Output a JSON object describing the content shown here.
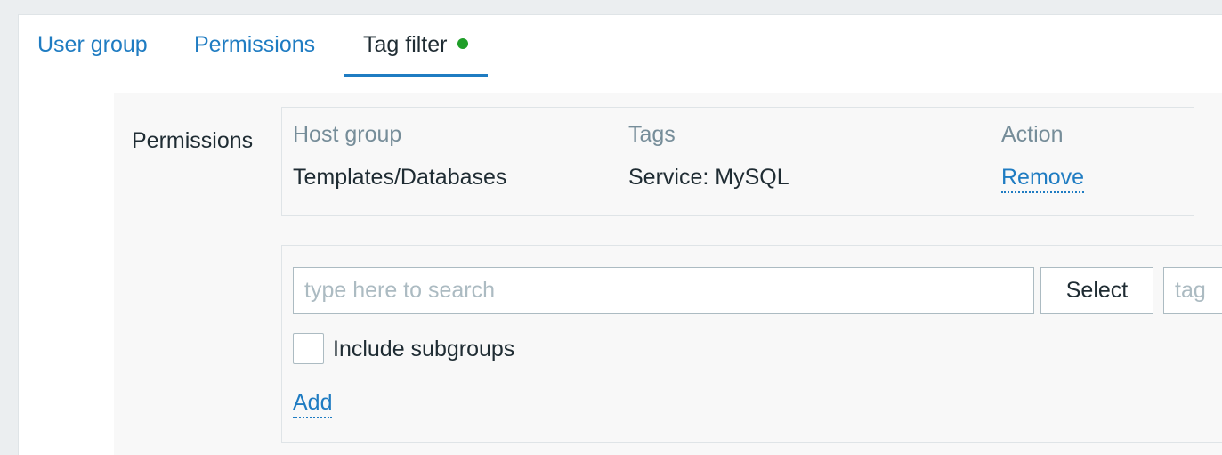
{
  "tabs": [
    {
      "label": "User group"
    },
    {
      "label": "Permissions"
    },
    {
      "label": "Tag filter",
      "active": true
    }
  ],
  "form": {
    "label": "Permissions",
    "table": {
      "headers": [
        "Host group",
        "Tags",
        "Action"
      ],
      "rows": [
        {
          "host_group": "Templates/Databases",
          "tags": "Service: MySQL",
          "action": "Remove"
        }
      ]
    },
    "add_section": {
      "search_placeholder": "type here to search",
      "select_label": "Select",
      "tag_placeholder": "tag",
      "include_subgroups_label": "Include subgroups",
      "add_label": "Add"
    }
  },
  "colors": {
    "link": "#1f7cc2",
    "active_tab_underline": "#1f7cc2",
    "status_dot": "#1f9e29",
    "header_text": "#768d99"
  }
}
